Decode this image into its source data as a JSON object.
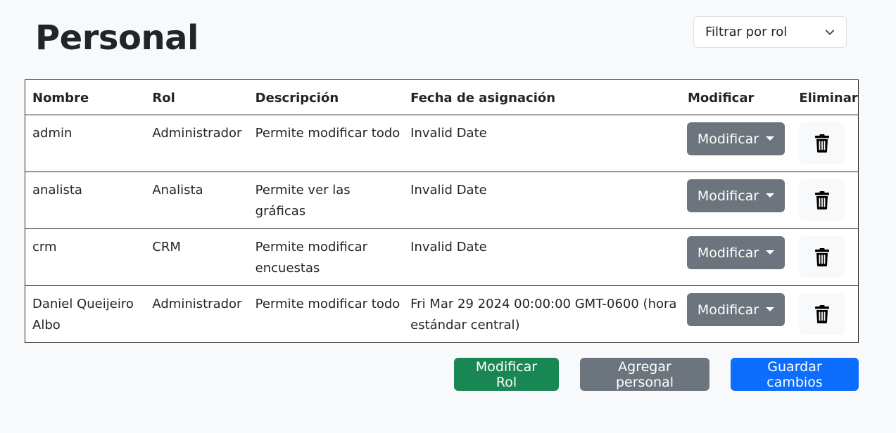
{
  "header": {
    "title": "Personal",
    "filter_placeholder": "Filtrar por rol"
  },
  "table": {
    "columns": [
      "Nombre",
      "Rol",
      "Descripción",
      "Fecha de asignación",
      "Modificar",
      "Eliminar"
    ],
    "rows": [
      {
        "name": "admin",
        "role": "Administrador",
        "description": "Permite modificar todo",
        "date": "Invalid Date",
        "modify_label": "Modificar"
      },
      {
        "name": "analista",
        "role": "Analista",
        "description": "Permite ver las gráficas",
        "date": "Invalid Date",
        "modify_label": "Modificar"
      },
      {
        "name": "crm",
        "role": "CRM",
        "description": "Permite modificar encuestas",
        "date": "Invalid Date",
        "modify_label": "Modificar"
      },
      {
        "name": "Daniel Queijeiro Albo",
        "role": "Administrador",
        "description": "Permite modificar todo",
        "date": "Fri Mar 29 2024 00:00:00 GMT-0600 (hora estándar central)",
        "modify_label": "Modificar"
      }
    ]
  },
  "actions": {
    "modify_role": "Modificar Rol",
    "add_staff": "Agregar personal",
    "save_changes": "Guardar cambios"
  },
  "icons": {
    "delete": "trash-icon",
    "dropdown": "chevron-down-icon",
    "caret": "caret-down-icon"
  },
  "colors": {
    "success": "#198754",
    "secondary": "#6c757d",
    "primary": "#0d6efd"
  }
}
